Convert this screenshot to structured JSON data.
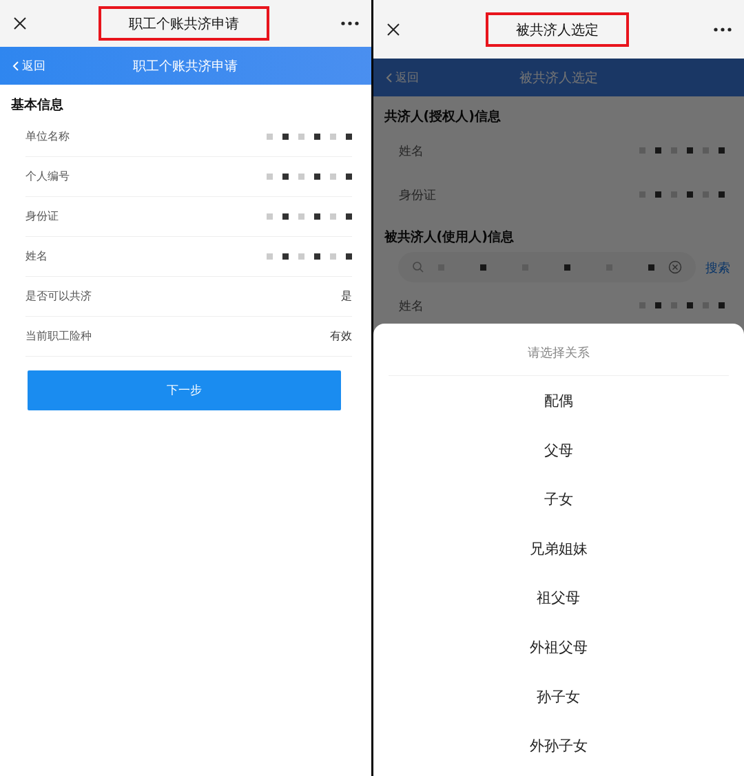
{
  "panels": [
    {
      "topbar": {
        "title": "职工个账共济申请",
        "highlighted": true
      },
      "header": {
        "back": "返回",
        "title": "职工个账共济申请"
      },
      "sections": [
        {
          "title": "基本信息",
          "rows": [
            {
              "label": "单位名称",
              "redacted": true
            },
            {
              "label": "个人编号",
              "redacted": true
            },
            {
              "label": "身份证",
              "redacted": true
            },
            {
              "label": "姓名",
              "redacted": true
            },
            {
              "label": "是否可以共济",
              "value": "是"
            },
            {
              "label": "当前职工险种",
              "value": "有效"
            }
          ]
        }
      ],
      "button": "下一步"
    },
    {
      "topbar": {
        "title": "被共济人选定",
        "highlighted": true
      },
      "header": {
        "back": "返回",
        "title": "被共济人选定"
      },
      "sections": [
        {
          "title": "共济人(授权人)信息",
          "rows": [
            {
              "label": "姓名",
              "redacted": true
            },
            {
              "label": "身份证",
              "redacted": true
            }
          ]
        },
        {
          "title": "被共济人(使用人)信息",
          "search": {
            "redacted": true,
            "action": "搜索"
          },
          "rows": [
            {
              "label": "姓名",
              "redacted": true
            }
          ]
        }
      ],
      "dimmed": true,
      "sheet": {
        "title": "请选择关系",
        "options": [
          "配偶",
          "父母",
          "子女",
          "兄弟姐妹",
          "祖父母",
          "外祖父母",
          "孙子女",
          "外孙子女"
        ]
      }
    }
  ]
}
